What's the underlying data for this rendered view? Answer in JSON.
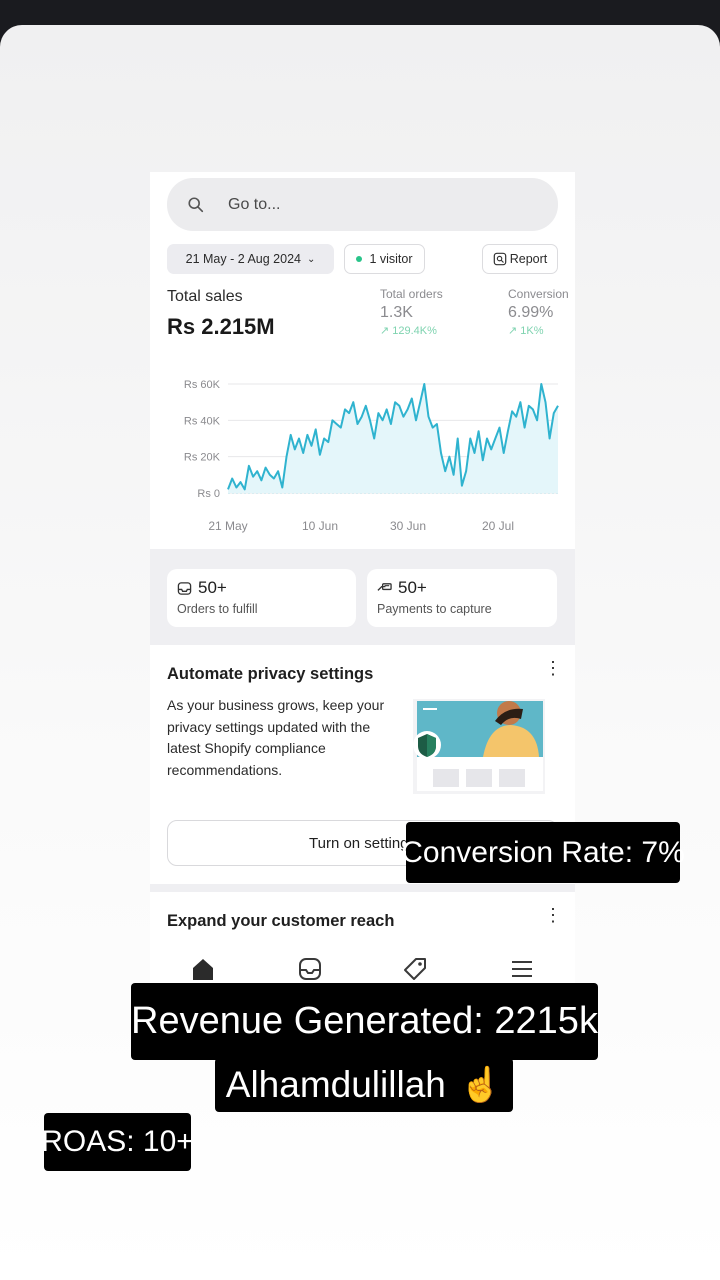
{
  "app": {
    "search": {
      "placeholder": "Go to..."
    },
    "filters": {
      "date_range": "21 May - 2 Aug 2024",
      "visitors": "1 visitor",
      "report_label": "Report"
    },
    "metrics": {
      "total_sales": {
        "label": "Total sales",
        "value": "Rs 2.215M"
      },
      "total_orders": {
        "label": "Total orders",
        "value": "1.3K",
        "delta": "↗ 129.4K%"
      },
      "conversion": {
        "label": "Conversion",
        "value": "6.99%",
        "delta": "↗ 1K%"
      }
    },
    "cards": {
      "orders": {
        "value": "50+",
        "label": "Orders to fulfill"
      },
      "payments": {
        "value": "50+",
        "label": "Payments to capture"
      }
    },
    "promo": {
      "title": "Automate privacy settings",
      "body": "As your business grows, keep your privacy settings updated with the latest Shopify compliance recommendations.",
      "cta": "Turn on settings"
    },
    "next_card": {
      "title": "Expand your customer reach"
    },
    "tabs": [
      "home-icon",
      "orders-icon",
      "products-icon",
      "menu-icon"
    ]
  },
  "overlays": {
    "conversion_rate": "Conversion Rate: 7%",
    "revenue": "Revenue Generated:  2215k",
    "alhamdulillah": "Alhamdulillah",
    "emoji": "☝️",
    "roas": "ROAS: 10+"
  },
  "colors": {
    "accent_line": "#2fb3cf",
    "fill": "#e4f6fa",
    "success": "#29c48a"
  },
  "chart_data": {
    "type": "line",
    "x_ticks": [
      "21 May",
      "10 Jun",
      "30 Jun",
      "20 Jul"
    ],
    "y_ticks": [
      "Rs 60K",
      "Rs 40K",
      "Rs 20K",
      "Rs 0"
    ],
    "ylim": [
      0,
      60000
    ],
    "grid": true,
    "series": [
      {
        "values": [
          2000,
          8000,
          3000,
          6000,
          2000,
          15000,
          9000,
          12000,
          7000,
          14000,
          10000,
          8000,
          12000,
          3000,
          20000,
          32000,
          24000,
          30000,
          22000,
          32000,
          26000,
          35000,
          21000,
          30000,
          28000,
          40000,
          38000,
          36000,
          46000,
          44000,
          50000,
          38000,
          42000,
          48000,
          40000,
          30000,
          44000,
          40000,
          46000,
          38000,
          50000,
          48000,
          42000,
          46000,
          52000,
          40000,
          50000,
          60000,
          42000,
          36000,
          38000,
          22000,
          12000,
          20000,
          10000,
          30000,
          4000,
          12000,
          30000,
          22000,
          34000,
          18000,
          30000,
          24000,
          30000,
          36000,
          22000,
          34000,
          45000,
          42000,
          50000,
          36000,
          48000,
          46000,
          40000,
          60000,
          50000,
          30000,
          44000,
          48000
        ]
      }
    ],
    "baseline_series": {
      "values": [
        0,
        0
      ]
    }
  }
}
